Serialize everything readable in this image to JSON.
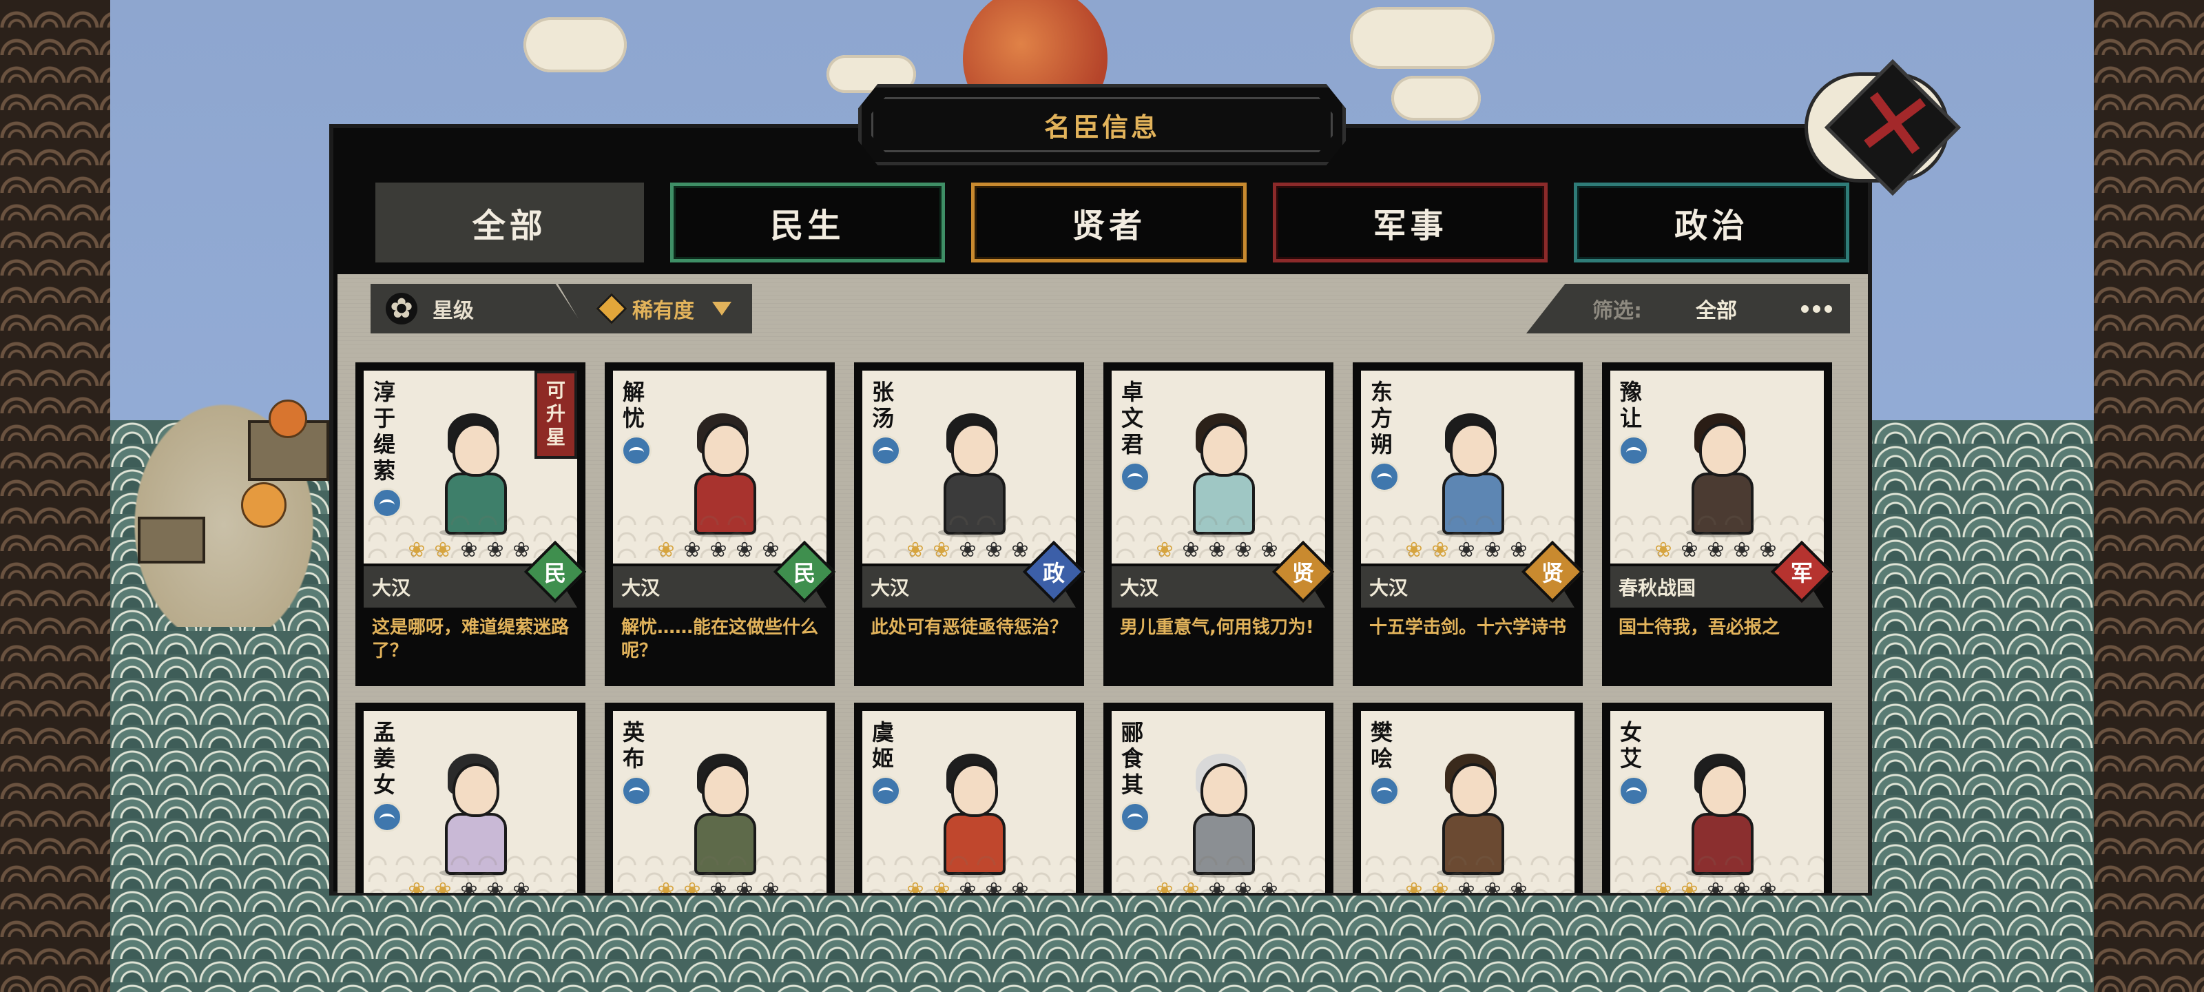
{
  "title": "名臣信息",
  "tabs": [
    {
      "label": "全部",
      "style": "active"
    },
    {
      "label": "民生",
      "style": "green"
    },
    {
      "label": "贤者",
      "style": "gold"
    },
    {
      "label": "军事",
      "style": "red"
    },
    {
      "label": "政治",
      "style": "teal"
    }
  ],
  "sort": {
    "star_label": "星级",
    "rarity_label": "稀有度"
  },
  "filter": {
    "label": "筛选:",
    "value": "全部"
  },
  "type_colors": {
    "民": "#3f8f4e",
    "政": "#3c5fa8",
    "贤": "#c98a2f",
    "军": "#b6332f"
  },
  "cards": [
    {
      "name": "淳于缇萦",
      "stars": 2,
      "dynasty": "大汉",
      "type": "民",
      "quote": "这是哪呀，难道缇萦迷路了？",
      "upgrade": "可升星",
      "robe": "#3e7f6a",
      "hair": "#1c1c1c"
    },
    {
      "name": "解忧",
      "stars": 1,
      "dynasty": "大汉",
      "type": "民",
      "quote": "解忧……能在这做些什么呢？",
      "upgrade": "",
      "robe": "#a8332e",
      "hair": "#2a2320"
    },
    {
      "name": "张汤",
      "stars": 2,
      "dynasty": "大汉",
      "type": "政",
      "quote": "此处可有恶徒亟待惩治？",
      "upgrade": "",
      "robe": "#3b3b3b",
      "hair": "#1c1c1c"
    },
    {
      "name": "卓文君",
      "stars": 1,
      "dynasty": "大汉",
      "type": "贤",
      "quote": "男儿重意气,何用钱刀为!",
      "upgrade": "",
      "robe": "#9fc7c4",
      "hair": "#2b2119"
    },
    {
      "name": "东方朔",
      "stars": 2,
      "dynasty": "大汉",
      "type": "贤",
      "quote": "十五学击剑。十六学诗书",
      "upgrade": "",
      "robe": "#5d86b3",
      "hair": "#1c1c1c"
    },
    {
      "name": "豫让",
      "stars": 1,
      "dynasty": "春秋战国",
      "type": "军",
      "quote": "国士待我，吾必报之",
      "upgrade": "",
      "robe": "#4b3b32",
      "hair": "#2a1d15"
    },
    {
      "name": "孟姜女",
      "stars": 2,
      "dynasty": "",
      "type": "",
      "quote": "",
      "upgrade": "",
      "robe": "#c9b9d6",
      "hair": "#2a2a2a"
    },
    {
      "name": "英布",
      "stars": 2,
      "dynasty": "",
      "type": "",
      "quote": "",
      "upgrade": "",
      "robe": "#5e6a4a",
      "hair": "#1e1e1e"
    },
    {
      "name": "虞姬",
      "stars": 2,
      "dynasty": "",
      "type": "",
      "quote": "",
      "upgrade": "",
      "robe": "#c0472d",
      "hair": "#1e1e1e"
    },
    {
      "name": "郦食其",
      "stars": 2,
      "dynasty": "",
      "type": "",
      "quote": "",
      "upgrade": "",
      "robe": "#8b8f93",
      "hair": "#d9d9d9"
    },
    {
      "name": "樊哙",
      "stars": 2,
      "dynasty": "",
      "type": "",
      "quote": "",
      "upgrade": "",
      "robe": "#6b4a32",
      "hair": "#3a2a1c"
    },
    {
      "name": "女艾",
      "stars": 2,
      "dynasty": "",
      "type": "",
      "quote": "",
      "upgrade": "",
      "robe": "#8b2f2f",
      "hair": "#1e1e1e"
    }
  ]
}
